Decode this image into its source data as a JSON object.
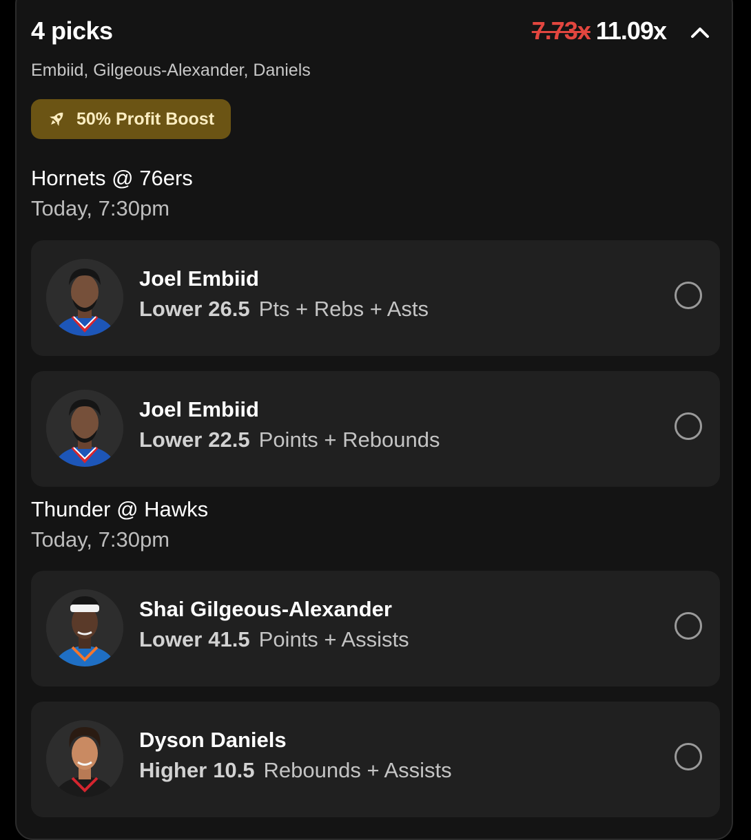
{
  "header": {
    "title": "4 picks",
    "old_multiplier": "7.73x",
    "new_multiplier": "11.09x",
    "players_summary": "Embiid, Gilgeous-Alexander, Daniels",
    "collapse_icon": "chevron-up-icon"
  },
  "boost": {
    "label": "50% Profit Boost",
    "icon": "rocket-icon",
    "background": "#6b5414",
    "text_color": "#fbedc1"
  },
  "colors": {
    "strikethrough_red": "#e2463f",
    "card_bg": "#202020",
    "panel_bg": "#141414"
  },
  "games": [
    {
      "title": "Hornets @ 76ers",
      "time": "Today, 7:30pm",
      "picks": [
        {
          "player": "Joel Embiid",
          "direction": "Lower",
          "line": "26.5",
          "stat": "Pts + Rebs + Asts",
          "jersey": "sixers"
        },
        {
          "player": "Joel Embiid",
          "direction": "Lower",
          "line": "22.5",
          "stat": "Points + Rebounds",
          "jersey": "sixers"
        }
      ]
    },
    {
      "title": "Thunder @ Hawks",
      "time": "Today, 7:30pm",
      "picks": [
        {
          "player": "Shai Gilgeous-Alexander",
          "direction": "Lower",
          "line": "41.5",
          "stat": "Points + Assists",
          "jersey": "thunder"
        },
        {
          "player": "Dyson Daniels",
          "direction": "Higher",
          "line": "10.5",
          "stat": "Rebounds + Assists",
          "jersey": "hawks"
        }
      ]
    }
  ]
}
